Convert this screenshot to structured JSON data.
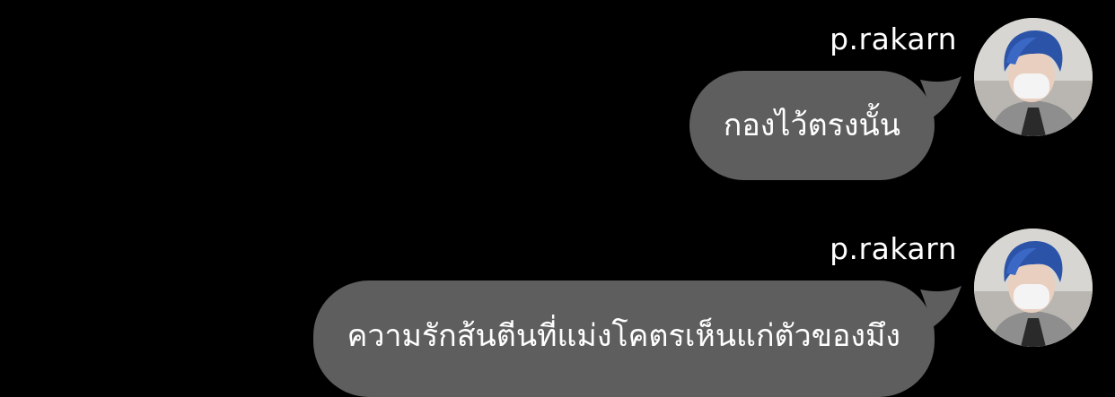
{
  "messages": [
    {
      "sender": "p.rakarn",
      "text": "กองไว้ตรงนั้น"
    },
    {
      "sender": "p.rakarn",
      "text": "ความรักส้นตีนที่แม่งโคตรเห็นแก่ตัวของมึง"
    }
  ],
  "colors": {
    "background": "#000000",
    "bubble": "#5e5e5e",
    "text": "#ffffff"
  }
}
